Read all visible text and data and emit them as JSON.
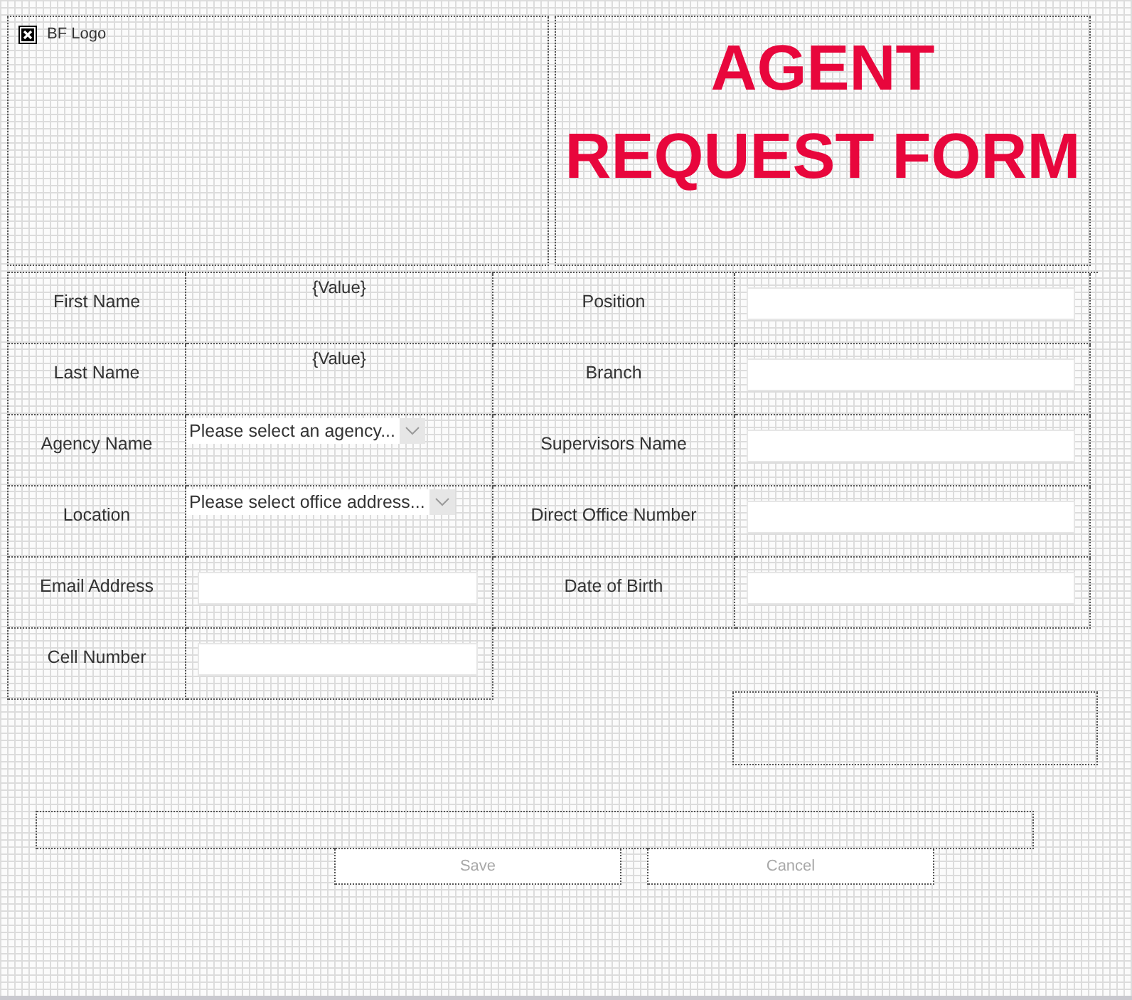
{
  "header": {
    "logo": {
      "alt_text": "BF Logo"
    },
    "title_lines": [
      "AGENT",
      "REQUEST FORM"
    ]
  },
  "left_fields": [
    {
      "label": "First Name",
      "kind": "value",
      "value": "{Value}"
    },
    {
      "label": "Last Name",
      "kind": "value",
      "value": "{Value}"
    },
    {
      "label": "Agency Name",
      "kind": "dropdown",
      "value": "Please select an agency..."
    },
    {
      "label": "Location",
      "kind": "dropdown",
      "value": "Please select office address..."
    },
    {
      "label": "Email Address",
      "kind": "input"
    },
    {
      "label": "Cell Number",
      "kind": "input"
    }
  ],
  "right_fields": [
    {
      "label": "Position",
      "kind": "input"
    },
    {
      "label": "Branch",
      "kind": "input"
    },
    {
      "label": "Supervisors Name",
      "kind": "input"
    },
    {
      "label": "Direct Office Number",
      "kind": "input"
    },
    {
      "label": "Date of Birth",
      "kind": "input"
    }
  ],
  "buttons": [
    {
      "label": "Save",
      "disabled": true
    },
    {
      "label": "Cancel",
      "disabled": true
    }
  ]
}
